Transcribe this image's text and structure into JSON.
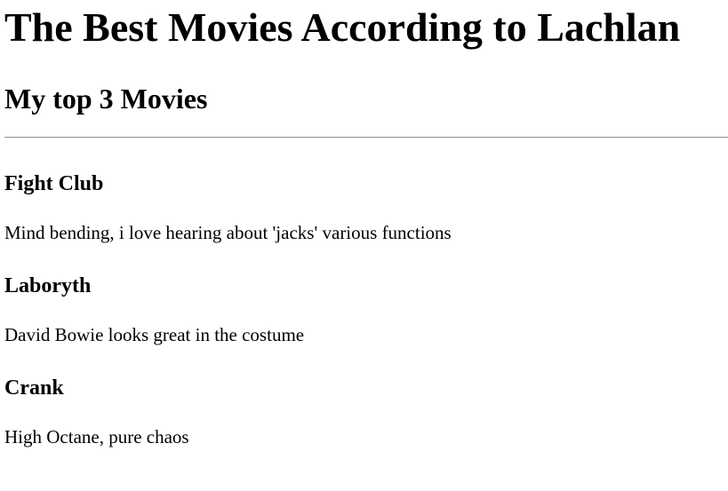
{
  "page": {
    "title": "The Best Movies According to Lachlan",
    "subtitle": "My top 3 Movies"
  },
  "movies": [
    {
      "title": "Fight Club",
      "description": "Mind bending, i love hearing about 'jacks' various functions"
    },
    {
      "title": "Laboryth",
      "description": "David Bowie looks great in the costume"
    },
    {
      "title": "Crank",
      "description": "High Octane, pure chaos"
    }
  ]
}
